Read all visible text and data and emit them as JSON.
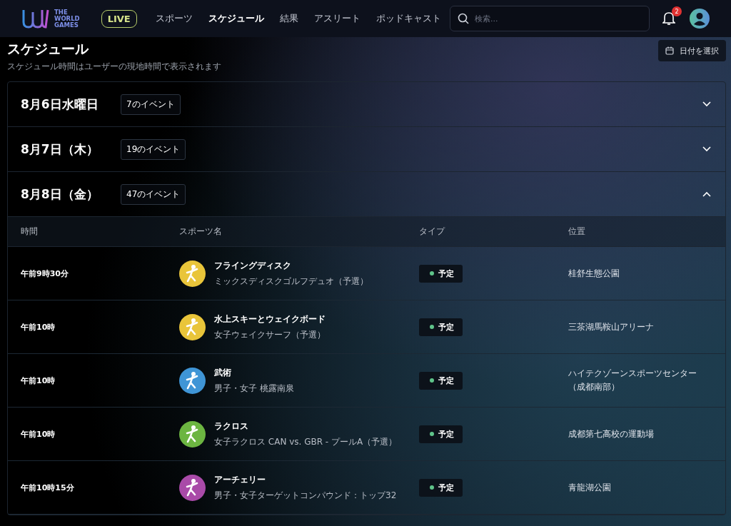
{
  "nav": {
    "logo": [
      "THE",
      "WORLD",
      "GAMES"
    ],
    "live": "LIVE",
    "links": [
      {
        "label": "スポーツ",
        "selected": false
      },
      {
        "label": "スケジュール",
        "selected": true
      },
      {
        "label": "結果",
        "selected": false
      },
      {
        "label": "アスリート",
        "selected": false
      },
      {
        "label": "ポッドキャスト",
        "selected": false
      }
    ],
    "search": {
      "placeholder": "検索..."
    },
    "notifications": "2"
  },
  "page": {
    "title": "スケジュール",
    "subtitle": "スケジュール時間はユーザーの現地時間で表示されます",
    "date_button": "日付を選択"
  },
  "days": [
    {
      "date": "8月6日水曜日",
      "count": "7のイベント",
      "expanded": false
    },
    {
      "date": "8月7日（木）",
      "count": "19のイベント",
      "expanded": false
    },
    {
      "date": "8月8日（金）",
      "count": "47のイベント",
      "expanded": true,
      "columns": [
        "時間",
        "スポーツ名",
        "タイプ",
        "位置"
      ],
      "events": [
        {
          "time": "午前9時30分",
          "sport": "フライングディスク",
          "detail": "ミックスディスクゴルフデュオ（予選）",
          "color": "#e9c53a",
          "type": "予定",
          "location": "桂舒生態公園"
        },
        {
          "time": "午前10時",
          "sport": "水上スキーとウェイクボード",
          "detail": "女子ウェイクサーフ（予選）",
          "color": "#e9c53a",
          "type": "予定",
          "location": "三茶湖馬鞍山アリーナ"
        },
        {
          "time": "午前10時",
          "sport": "武術",
          "detail": "男子・女子 桃露南泉",
          "color": "#3f95d6",
          "type": "予定",
          "location": "ハイテクゾーンスポーツセンター（成都南部）"
        },
        {
          "time": "午前10時",
          "sport": "ラクロス",
          "detail": "女子ラクロス CAN vs. GBR - プールA（予選）",
          "color": "#6cb541",
          "type": "予定",
          "location": "成都第七高校の運動場"
        },
        {
          "time": "午前10時15分",
          "sport": "アーチェリー",
          "detail": "男子・女子ターゲットコンパウンド：トップ32",
          "color": "#a94aa8",
          "type": "予定",
          "location": "青龍湖公園"
        }
      ]
    }
  ]
}
